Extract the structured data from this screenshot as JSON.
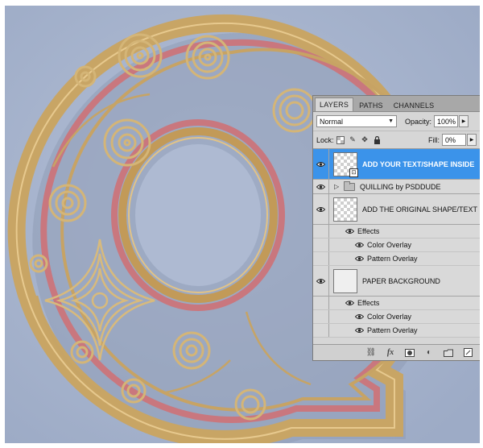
{
  "panel": {
    "tabs": [
      {
        "label": "LAYERS"
      },
      {
        "label": "PATHS"
      },
      {
        "label": "CHANNELS"
      }
    ],
    "blend_mode": "Normal",
    "opacity_label": "Opacity:",
    "opacity_value": "100%",
    "lock_label": "Lock:",
    "fill_label": "Fill:",
    "fill_value": "0%"
  },
  "layers": [
    {
      "name": "ADD YOUR TEXT/SHAPE INSIDE",
      "selected": true
    },
    {
      "name": "QUILLING by PSDDUDE",
      "type": "group"
    },
    {
      "name": "ADD THE ORIGINAL SHAPE/TEXT"
    },
    {
      "name": "PAPER BACKGROUND"
    }
  ],
  "effects": {
    "original": {
      "header": "Effects",
      "items": [
        "Color Overlay",
        "Pattern Overlay"
      ]
    },
    "background": {
      "header": "Effects",
      "items": [
        "Color Overlay",
        "Pattern Overlay"
      ]
    }
  },
  "colors": {
    "canvas": "#a9b6cf",
    "paper_gold": "#c9a867",
    "paper_pink": "#c9777e",
    "selection": "#3b93ea"
  }
}
